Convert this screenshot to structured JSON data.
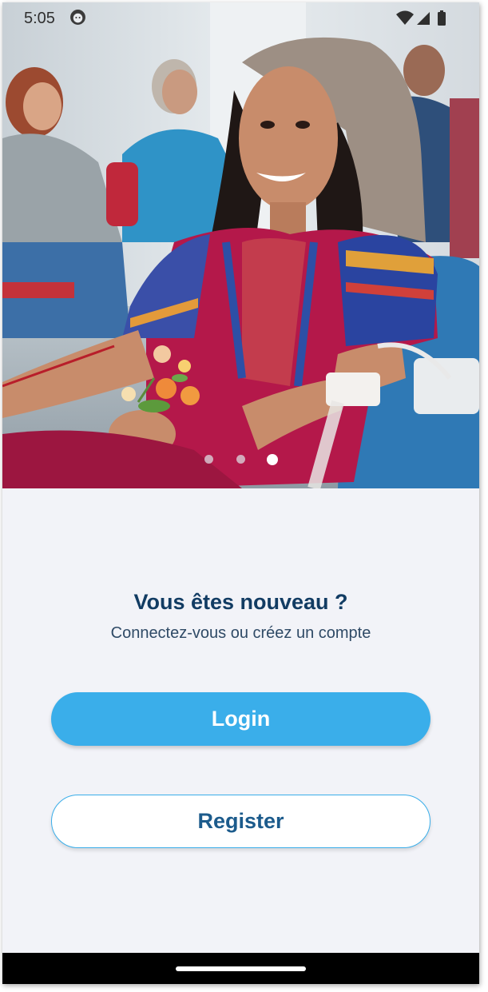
{
  "status_bar": {
    "time": "5:05",
    "icons": [
      "face-icon",
      "wifi-icon",
      "signal-icon",
      "battery-icon"
    ]
  },
  "hero": {
    "image_description_icon": "blood-donation-photo",
    "carousel": {
      "total_pages": 3,
      "active_page": 3
    }
  },
  "welcome": {
    "title": "Vous êtes nouveau ?",
    "subtitle": "Connectez-vous ou créez un compte"
  },
  "actions": {
    "login_label": "Login",
    "register_label": "Register"
  },
  "colors": {
    "primary": "#3aaeea",
    "title": "#123c63",
    "register_text": "#1c5b8c",
    "background": "#f2f3f8"
  }
}
